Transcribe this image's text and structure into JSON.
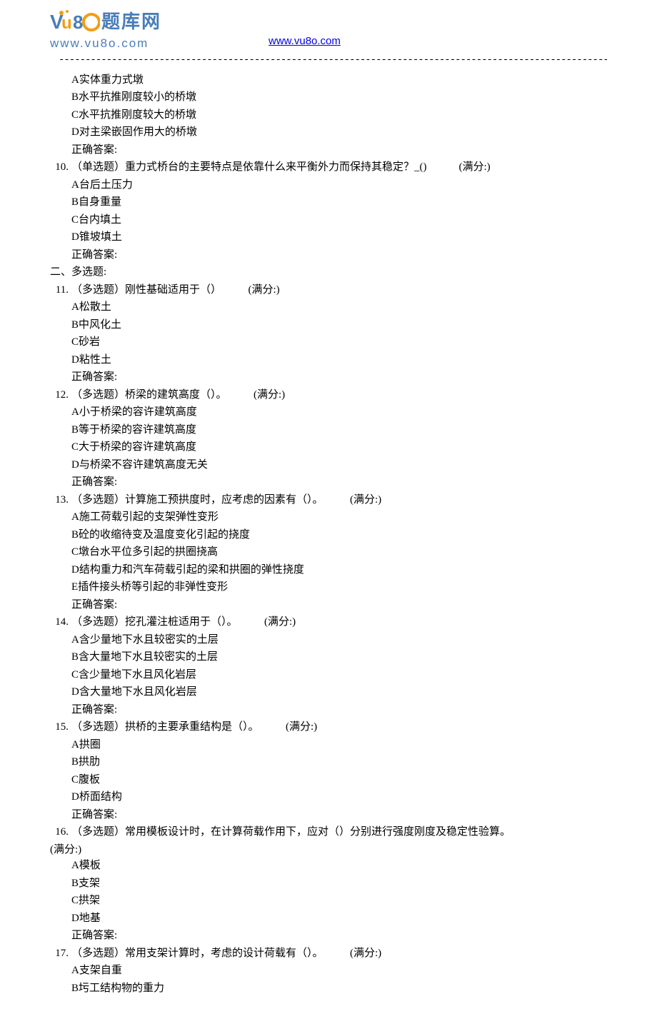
{
  "header": {
    "logo_cn_part1": "题库网",
    "logo_url_text": "www.vu8o.com",
    "header_link": "www.vu8o.com"
  },
  "pre_options": [
    "A实体重力式墩",
    "B水平抗推刚度较小的桥墩",
    "C水平抗推刚度较大的桥墩",
    "D对主梁嵌固作用大的桥墩"
  ],
  "answer_label": "正确答案:",
  "section2_title": "二、多选题:",
  "score_label": "(满分:)",
  "questions": [
    {
      "num": "10.",
      "prefix": "（单选题）",
      "text": "重力式桥台的主要特点是依靠什么来平衡外力而保持其稳定？_()",
      "score_spacing": "            ",
      "options": [
        "A台后土压力",
        "B自身重量",
        "C台内填土",
        "D锥坡填土"
      ]
    },
    {
      "num": "11.",
      "prefix": "（多选题）",
      "text": "刚性基础适用于（）",
      "score_spacing": "          ",
      "options": [
        "A松散土",
        "B中风化土",
        "C砂岩",
        "D粘性土"
      ]
    },
    {
      "num": "12.",
      "prefix": "（多选题）",
      "text": "桥梁的建筑高度（）。",
      "score_spacing": "          ",
      "options": [
        "A小于桥梁的容许建筑高度",
        "B等于桥梁的容许建筑高度",
        "C大于桥梁的容许建筑高度",
        "D与桥梁不容许建筑高度无关"
      ]
    },
    {
      "num": "13.",
      "prefix": "（多选题）",
      "text": "计算施工预拱度时，应考虑的因素有（）。",
      "score_spacing": "          ",
      "options": [
        "A施工荷载引起的支架弹性变形",
        "B砼的收缩待变及温度变化引起的挠度",
        "C墩台水平位多引起的拱圈挠高",
        "D结构重力和汽车荷载引起的梁和拱圈的弹性挠度",
        "E插件接头桥等引起的非弹性变形"
      ]
    },
    {
      "num": "14.",
      "prefix": "（多选题）",
      "text": "挖孔灌注桩适用于（）。",
      "score_spacing": "          ",
      "options": [
        "A含少量地下水且较密实的土层",
        "B含大量地下水且较密实的土层",
        "C含少量地下水且风化岩层",
        "D含大量地下水且风化岩层"
      ]
    },
    {
      "num": "15.",
      "prefix": "（多选题）",
      "text": "拱桥的主要承重结构是（）。",
      "score_spacing": "          ",
      "options": [
        "A拱圈",
        "B拱肋",
        "C腹板",
        "D桥面结构"
      ]
    },
    {
      "num": "16.",
      "prefix": "（多选题）",
      "text": "常用模板设计时，在计算荷载作用下，应对（）分别进行强度刚度及稳定性验算。",
      "score_spacing": "          ",
      "score_newline": true,
      "options": [
        "A模板",
        "B支架",
        "C拱架",
        "D地基"
      ]
    },
    {
      "num": "17.",
      "prefix": "（多选题）",
      "text": "常用支架计算时，考虑的设计荷载有（）。",
      "score_spacing": "          ",
      "options": [
        "A支架自重",
        "B圬工结构物的重力"
      ],
      "no_answer": true
    }
  ]
}
